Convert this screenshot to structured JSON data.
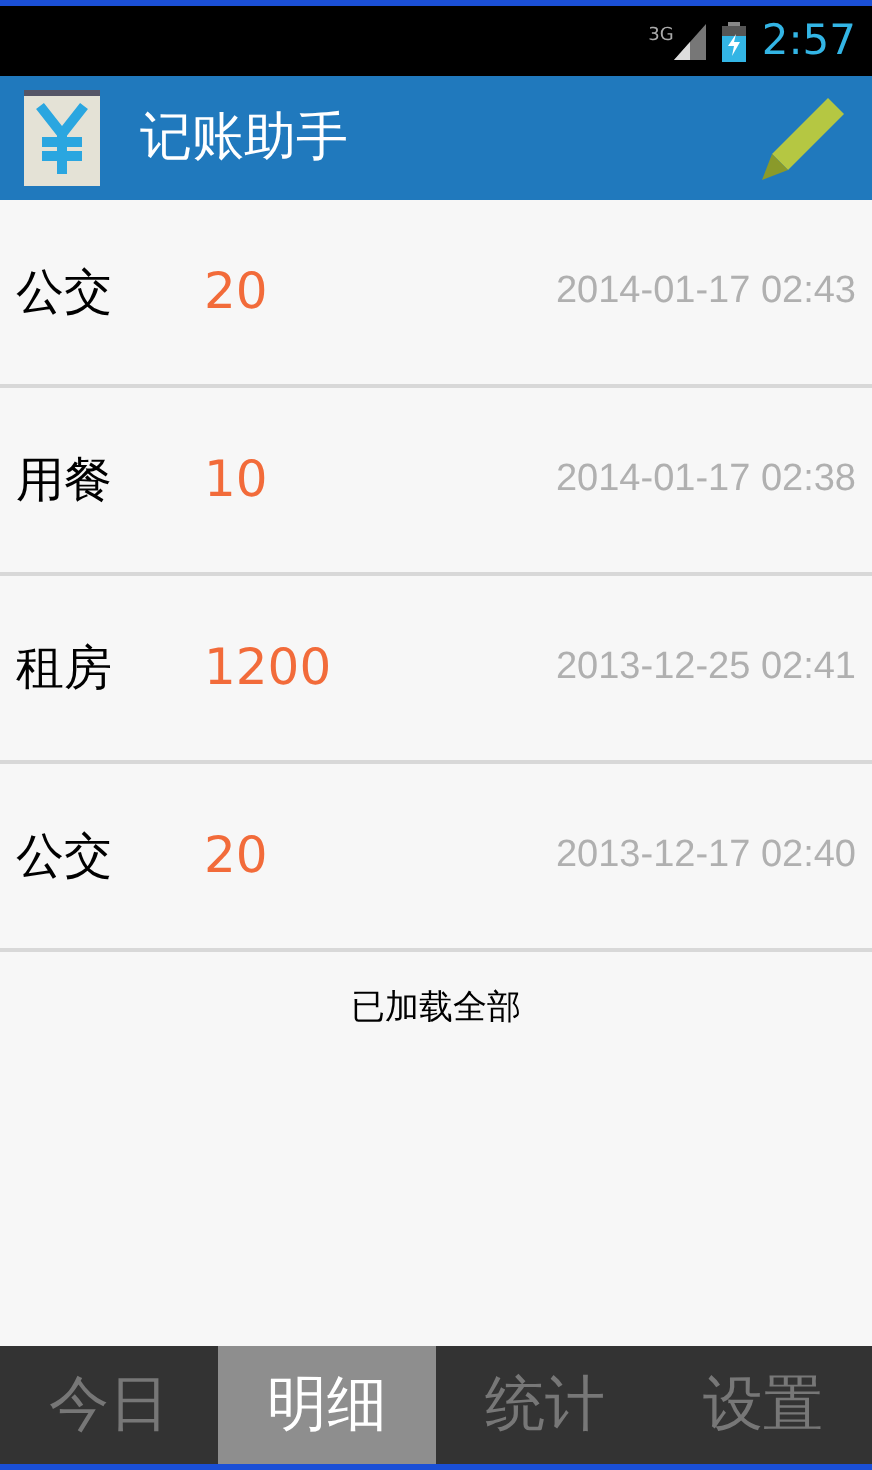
{
  "status_bar": {
    "network": "3G",
    "time": "2:57"
  },
  "app_bar": {
    "title": "记账助手"
  },
  "records": [
    {
      "category": "公交",
      "amount": "20",
      "time": "2014-01-17 02:43"
    },
    {
      "category": "用餐",
      "amount": "10",
      "time": "2014-01-17 02:38"
    },
    {
      "category": "租房",
      "amount": "1200",
      "time": "2013-12-25 02:41"
    },
    {
      "category": "公交",
      "amount": "20",
      "time": "2013-12-17 02:40"
    }
  ],
  "footer": "已加载全部",
  "tabs": [
    {
      "label": "今日",
      "selected": false
    },
    {
      "label": "明细",
      "selected": true
    },
    {
      "label": "统计",
      "selected": false
    },
    {
      "label": "设置",
      "selected": false
    }
  ]
}
